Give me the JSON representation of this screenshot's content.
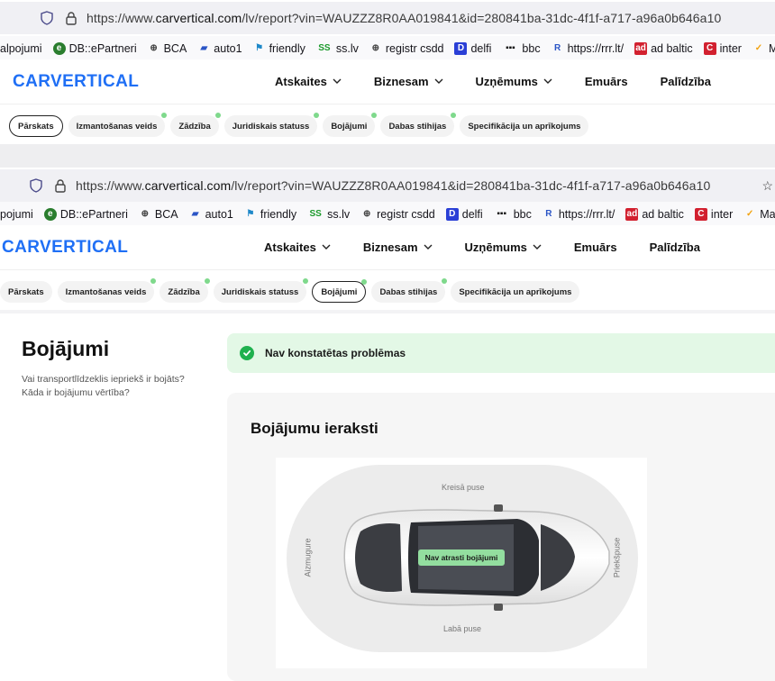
{
  "browser_top": {
    "url_prefix": "https://www.",
    "url_host": "carvertical.com",
    "url_path": "/lv/report?vin=WAUZZZ8R0AA019841&id=280841ba-31dc-4f1f-a717-a96a0b646a10"
  },
  "bookmarks_top": [
    {
      "label": "alpojumi",
      "icon": "none",
      "color": ""
    },
    {
      "label": "DB::ePartneri",
      "icon": "e-circle-icon",
      "color": "#2a7d2e"
    },
    {
      "label": "BCA",
      "icon": "globe-icon",
      "color": "#444"
    },
    {
      "label": "auto1",
      "icon": "auto1-icon",
      "color": "#2b55c6"
    },
    {
      "label": "friendly",
      "icon": "friendly-icon",
      "color": "#1e88c9"
    },
    {
      "label": "ss.lv",
      "icon": "ss-icon",
      "color": "#1b9a2b"
    },
    {
      "label": "registr csdd",
      "icon": "globe-icon",
      "color": "#444"
    },
    {
      "label": "delfi",
      "icon": "d-icon",
      "color": "#2a3fd6"
    },
    {
      "label": "bbc",
      "icon": "bbc-icon",
      "color": "#111"
    },
    {
      "label": "https://rrr.lt/",
      "icon": "r-icon",
      "color": "#2b55c6"
    },
    {
      "label": "ad baltic",
      "icon": "ad-icon",
      "color": "#d2202f"
    },
    {
      "label": "inter",
      "icon": "inter-icon",
      "color": "#d2202f"
    },
    {
      "label": "Mango",
      "icon": "mango-icon",
      "color": "#f2a20f"
    }
  ],
  "header_top": {
    "logo": "CARVERTICAL",
    "nav": [
      {
        "label": "Atskaites",
        "has_menu": true
      },
      {
        "label": "Biznesam",
        "has_menu": true
      },
      {
        "label": "Uzņēmums",
        "has_menu": true
      },
      {
        "label": "Emuārs",
        "has_menu": false
      },
      {
        "label": "Palīdzība",
        "has_menu": false
      }
    ]
  },
  "tabs_top": [
    {
      "label": "Pārskats",
      "active": true,
      "dot": false
    },
    {
      "label": "Izmantošanas veids",
      "active": false,
      "dot": true
    },
    {
      "label": "Zādzība",
      "active": false,
      "dot": true
    },
    {
      "label": "Juridiskais statuss",
      "active": false,
      "dot": true
    },
    {
      "label": "Bojājumi",
      "active": false,
      "dot": true
    },
    {
      "label": "Dabas stihijas",
      "active": false,
      "dot": true
    },
    {
      "label": "Specifikācija un aprīkojums",
      "active": false,
      "dot": false
    }
  ],
  "browser_bottom": {
    "url_prefix": "https://www.",
    "url_host": "carvertical.com",
    "url_path": "/lv/report?vin=WAUZZZ8R0AA019841&id=280841ba-31dc-4f1f-a717-a96a0b646a10"
  },
  "bookmarks_bottom": [
    {
      "label": "pojumi",
      "icon": "none",
      "color": ""
    },
    {
      "label": "DB::ePartneri",
      "icon": "e-circle-icon",
      "color": "#2a7d2e"
    },
    {
      "label": "BCA",
      "icon": "globe-icon",
      "color": "#444"
    },
    {
      "label": "auto1",
      "icon": "auto1-icon",
      "color": "#2b55c6"
    },
    {
      "label": "friendly",
      "icon": "friendly-icon",
      "color": "#1e88c9"
    },
    {
      "label": "ss.lv",
      "icon": "ss-icon",
      "color": "#1b9a2b"
    },
    {
      "label": "registr csdd",
      "icon": "globe-icon",
      "color": "#444"
    },
    {
      "label": "delfi",
      "icon": "d-icon",
      "color": "#2a3fd6"
    },
    {
      "label": "bbc",
      "icon": "bbc-icon",
      "color": "#111"
    },
    {
      "label": "https://rrr.lt/",
      "icon": "r-icon",
      "color": "#2b55c6"
    },
    {
      "label": "ad baltic",
      "icon": "ad-icon",
      "color": "#d2202f"
    },
    {
      "label": "inter",
      "icon": "inter-icon",
      "color": "#d2202f"
    },
    {
      "label": "Mango",
      "icon": "mango-icon",
      "color": "#f2a20f"
    }
  ],
  "tabs_bottom": [
    {
      "label": "Pārskats",
      "active": false,
      "dot": false
    },
    {
      "label": "Izmantošanas veids",
      "active": false,
      "dot": true
    },
    {
      "label": "Zādzība",
      "active": false,
      "dot": true
    },
    {
      "label": "Juridiskais statuss",
      "active": false,
      "dot": true
    },
    {
      "label": "Bojājumi",
      "active": true,
      "dot": true
    },
    {
      "label": "Dabas stihijas",
      "active": false,
      "dot": true
    },
    {
      "label": "Specifikācija un aprīkojums",
      "active": false,
      "dot": false
    }
  ],
  "damage": {
    "title": "Bojājumi",
    "question_1": "Vai transportlīdzeklis iepriekš ir bojāts?",
    "question_2": "Kāda ir bojājumu vērtība?",
    "status": "Nav konstatētas problēmas",
    "records_title": "Bojājumu ieraksti",
    "label_left_side": "Kreisā puse",
    "label_right_side": "Labā puse",
    "label_rear": "Aizmugure",
    "label_front": "Priekšpuse",
    "no_damage": "Nav atrasti bojājumi"
  },
  "colors": {
    "brand": "#1f6ff5",
    "ok_bg": "#e3f8e6",
    "ok_icon": "#1fb14e",
    "tab_dot": "#7fd98c",
    "no_damage_bg": "#93de9f"
  }
}
